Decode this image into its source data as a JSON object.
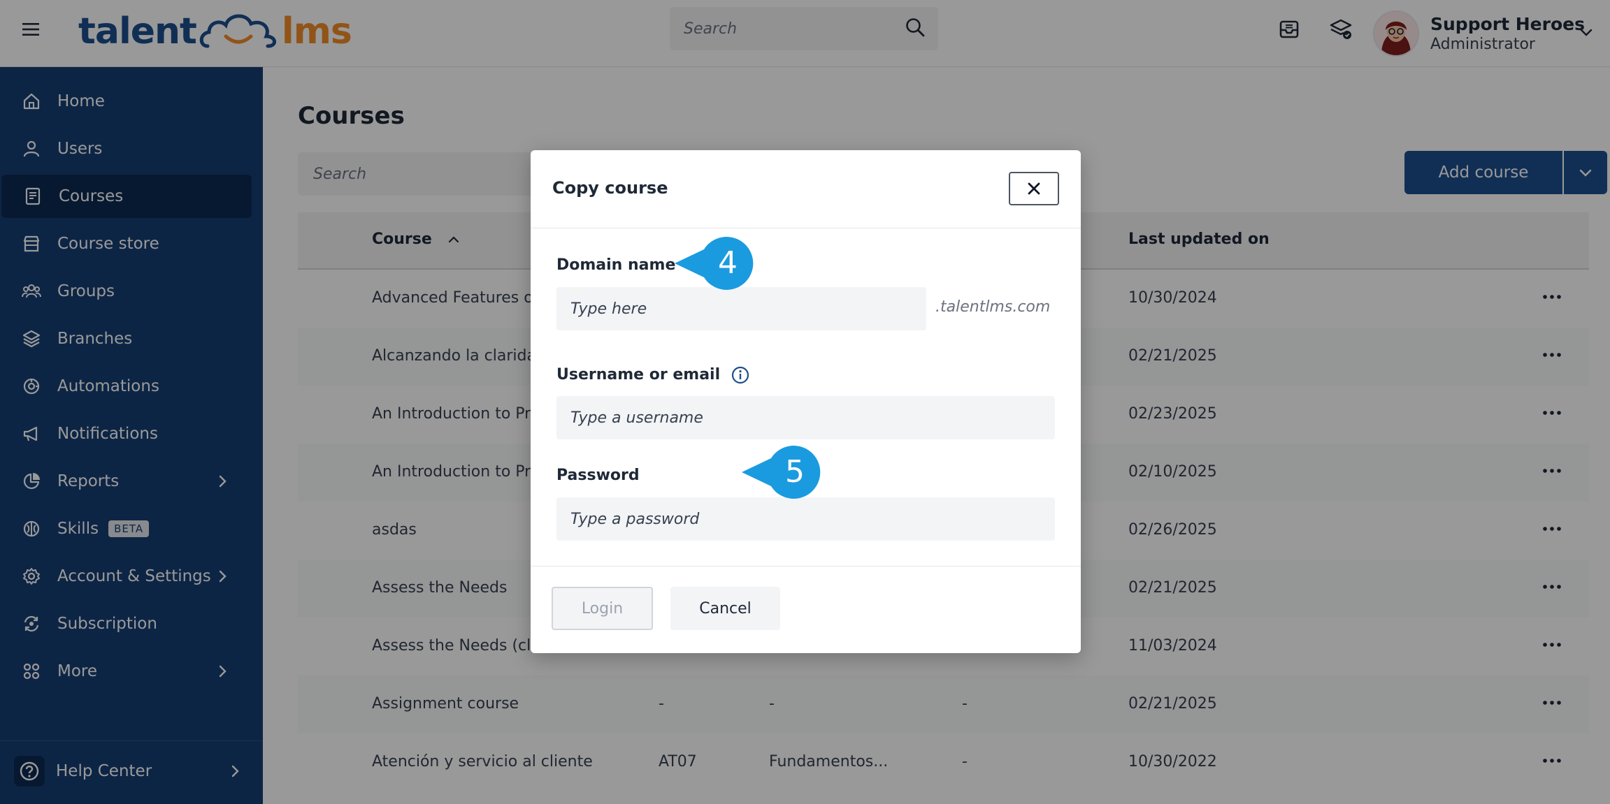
{
  "topbar": {
    "logo_left": "talent",
    "logo_right": "lms",
    "search_placeholder": "Search",
    "user_name": "Support Heroes",
    "user_role": "Administrator"
  },
  "sidebar": {
    "items": [
      {
        "label": "Home",
        "icon": "home-icon"
      },
      {
        "label": "Users",
        "icon": "user-icon"
      },
      {
        "label": "Courses",
        "icon": "book-icon",
        "active": true
      },
      {
        "label": "Course store",
        "icon": "store-icon"
      },
      {
        "label": "Groups",
        "icon": "group-icon"
      },
      {
        "label": "Branches",
        "icon": "layers-icon"
      },
      {
        "label": "Automations",
        "icon": "automation-icon"
      },
      {
        "label": "Notifications",
        "icon": "megaphone-icon"
      },
      {
        "label": "Reports",
        "icon": "pie-chart-icon",
        "has_submenu": true
      },
      {
        "label": "Skills",
        "icon": "brain-icon",
        "badge": "BETA"
      },
      {
        "label": "Account & Settings",
        "icon": "gear-icon",
        "has_submenu": true
      },
      {
        "label": "Subscription",
        "icon": "subscription-icon"
      },
      {
        "label": "More",
        "icon": "grid-icon",
        "has_submenu": true
      }
    ],
    "help_label": "Help Center"
  },
  "main": {
    "title": "Courses",
    "search_placeholder": "Search",
    "add_course_label": "Add course",
    "table": {
      "columns": [
        "Course",
        "Last updated on"
      ],
      "rows": [
        {
          "course": "Advanced Features of T",
          "code": "",
          "category": "",
          "price": "",
          "updated": "10/30/2024"
        },
        {
          "course": "Alcanzando la claridad",
          "code": "",
          "category": "",
          "price": "",
          "updated": "02/21/2025"
        },
        {
          "course": "An Introduction to Prop",
          "code": "",
          "category": "",
          "price": "",
          "updated": "02/23/2025"
        },
        {
          "course": "An Introduction to Prop",
          "code": "",
          "category": "",
          "price": "",
          "updated": "02/10/2025"
        },
        {
          "course": "asdas",
          "code": "",
          "category": "",
          "price": "",
          "updated": "02/26/2025"
        },
        {
          "course": "Assess the Needs",
          "code": "",
          "category": "",
          "price": "",
          "updated": "02/21/2025"
        },
        {
          "course": "Assess the Needs (clo",
          "code": "",
          "category": "",
          "price": "",
          "updated": "11/03/2024"
        },
        {
          "course": "Assignment course",
          "code": "-",
          "category": "-",
          "price": "-",
          "updated": "02/21/2025"
        },
        {
          "course": "Atención y servicio al cliente",
          "code": "AT07",
          "category": "Fundamentos...",
          "price": "-",
          "updated": "10/30/2022"
        }
      ]
    }
  },
  "modal": {
    "title": "Copy course",
    "domain_label": "Domain name",
    "domain_placeholder": "Type here",
    "domain_suffix": ".talentlms.com",
    "username_label": "Username or email",
    "username_placeholder": "Type a username",
    "password_label": "Password",
    "password_placeholder": "Type a password",
    "login_label": "Login",
    "cancel_label": "Cancel"
  },
  "callouts": {
    "first": "4",
    "second": "5"
  },
  "colors": {
    "sidebar_bg": "#163f74",
    "brand_blue": "#1d4f8e",
    "brand_orange": "#f28c28",
    "callout_blue": "#1a9be0"
  }
}
